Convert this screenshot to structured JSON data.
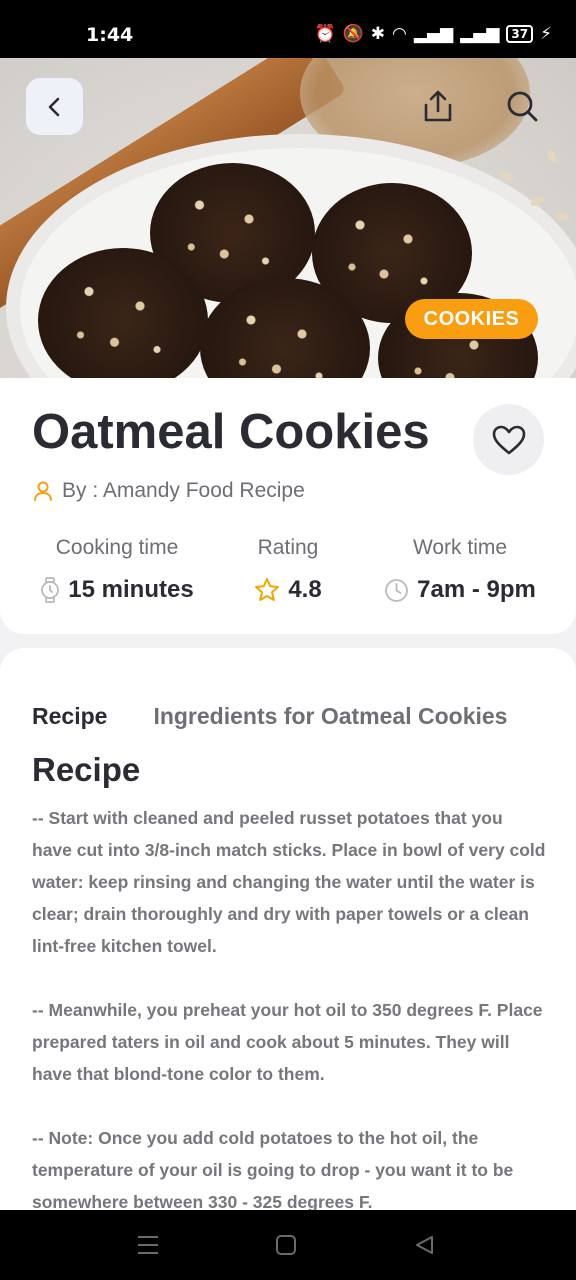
{
  "status_bar": {
    "time": "1:44",
    "battery": "37"
  },
  "hero": {
    "category_badge": "COOKIES",
    "accent_color": "#f99d11"
  },
  "recipe": {
    "title": "Oatmeal Cookies",
    "author": "By : Amandy Food Recipe",
    "stats": [
      {
        "label": "Cooking time",
        "value": "15 minutes",
        "icon": "stopwatch-icon"
      },
      {
        "label": "Rating",
        "value": "4.8",
        "icon": "star-icon"
      },
      {
        "label": "Work time",
        "value": "7am - 9pm",
        "icon": "clock-icon"
      }
    ]
  },
  "tabs": [
    {
      "label": "Recipe",
      "active": true
    },
    {
      "label": "Ingredients for Oatmeal Cookies",
      "active": false
    }
  ],
  "section": {
    "title": "Recipe",
    "paragraphs": [
      "-- Start with cleaned and peeled russet potatoes that you have cut into 3/8-inch match sticks. Place in bowl of very cold water: keep rinsing and changing the water until the water is clear; drain thoroughly and dry with paper towels or a clean lint-free kitchen towel.",
      " -- Meanwhile, you preheat your hot oil to 350 degrees F. Place prepared taters in oil and cook about 5 minutes. They will have that blond-tone color to them.",
      " -- Note: Once you add cold potatoes to the hot oil, the temperature of your oil is going to drop - you want it to be somewhere between 330 - 325 degrees F."
    ]
  }
}
